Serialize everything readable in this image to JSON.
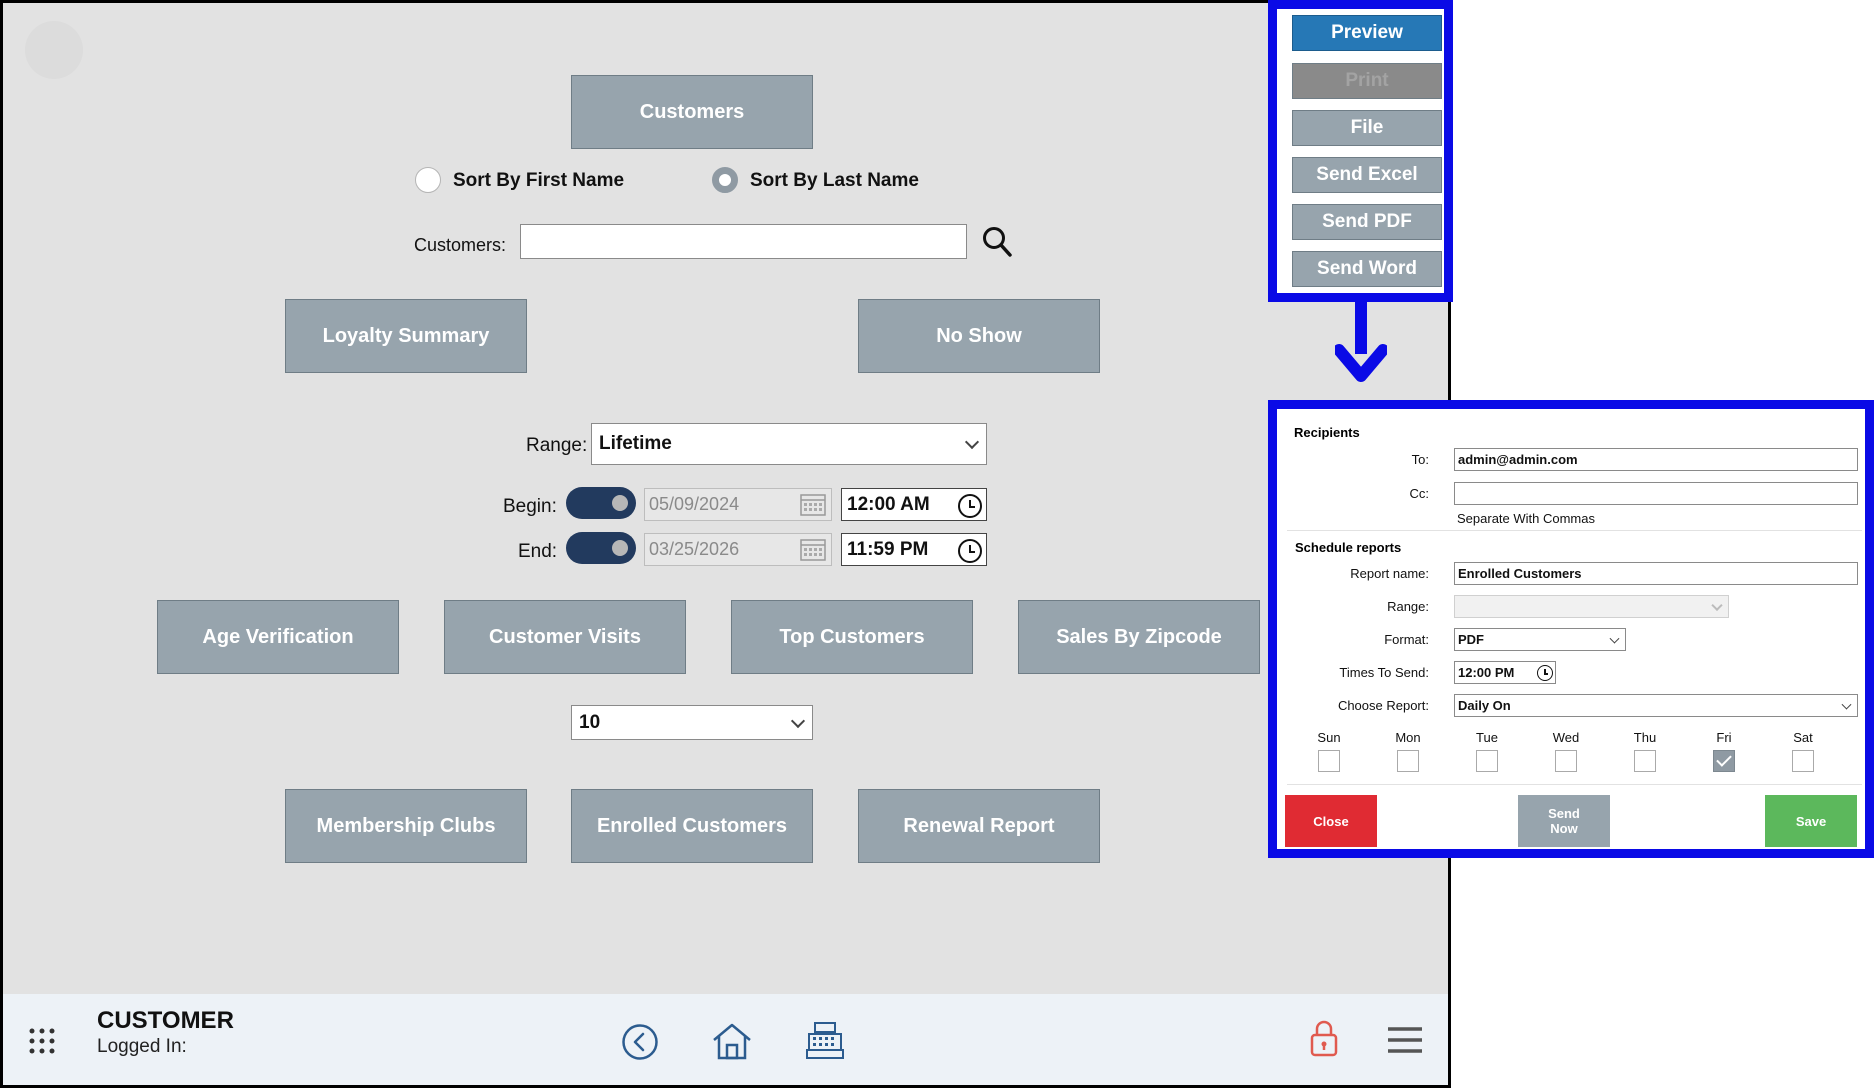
{
  "main": {
    "customers_button": "Customers",
    "sort_first": "Sort By First Name",
    "sort_last": "Sort By Last Name",
    "sort_selected": "last",
    "customers_label": "Customers:",
    "customers_value": "",
    "loyalty_summary": "Loyalty Summary",
    "no_show": "No Show",
    "range_label": "Range:",
    "range_value": "Lifetime",
    "begin_label": "Begin:",
    "begin_date": "05/09/2024",
    "begin_time": "12:00 AM",
    "end_label": "End:",
    "end_date": "03/25/2026",
    "end_time": "11:59 PM",
    "reports_row1": [
      "Age Verification",
      "Customer Visits",
      "Top Customers",
      "Sales By Zipcode"
    ],
    "top_count": "10",
    "reports_row2": [
      "Membership Clubs",
      "Enrolled Customers",
      "Renewal Report"
    ]
  },
  "footer": {
    "title": "CUSTOMER",
    "logged_in": "Logged In:",
    "icons": [
      "apps-grid-icon",
      "back-icon",
      "home-icon",
      "register-icon",
      "lock-icon",
      "menu-icon"
    ]
  },
  "export_panel": {
    "buttons": [
      "Preview",
      "Print",
      "File",
      "Send Excel",
      "Send PDF",
      "Send Word"
    ]
  },
  "schedule_dialog": {
    "recipients_header": "Recipients",
    "to_label": "To:",
    "to_value": "admin@admin.com",
    "cc_label": "Cc:",
    "cc_value": "",
    "cc_hint": "Separate With Commas",
    "schedule_header": "Schedule reports",
    "report_name_label": "Report name:",
    "report_name_value": "Enrolled Customers",
    "range_label": "Range:",
    "range_value": "",
    "format_label": "Format:",
    "format_value": "PDF",
    "times_label": "Times To Send:",
    "times_value": "12:00 PM",
    "choose_label": "Choose Report:",
    "choose_value": "Daily On",
    "days": [
      "Sun",
      "Mon",
      "Tue",
      "Wed",
      "Thu",
      "Fri",
      "Sat"
    ],
    "days_checked": [
      false,
      false,
      false,
      false,
      false,
      true,
      false
    ],
    "close": "Close",
    "send_now": "Send Now",
    "save": "Save"
  },
  "colors": {
    "panel_border": "#0a0ae6",
    "button_gray": "#97a4ad",
    "preview_blue": "#2678b6",
    "close_red": "#e02b33",
    "save_green": "#5cb85c",
    "toggle_navy": "#223a5e"
  }
}
